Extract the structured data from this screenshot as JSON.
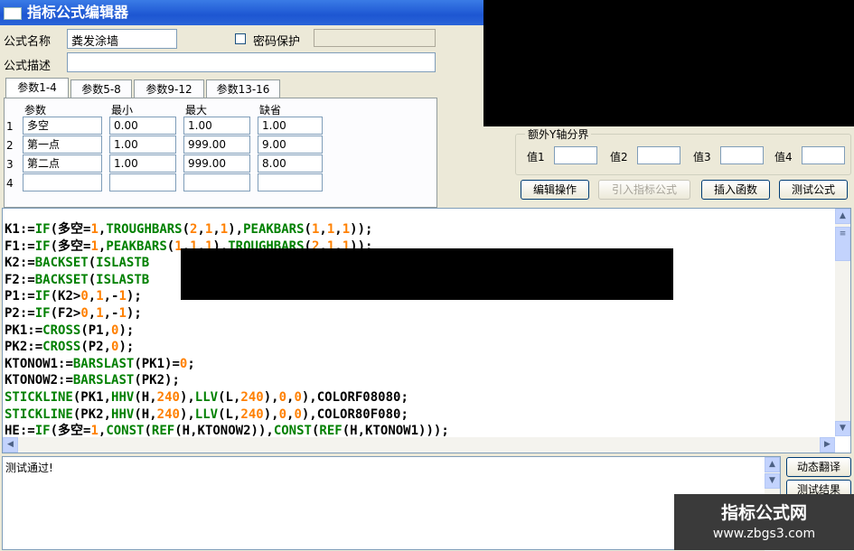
{
  "window": {
    "title": "指标公式编辑器"
  },
  "form": {
    "name_label": "公式名称",
    "name_value": "粪发涂墙",
    "password_label": "密码保护",
    "password_value": "",
    "password_checked": false,
    "desc_label": "公式描述",
    "desc_value": ""
  },
  "tabs": [
    {
      "label": "参数1-4",
      "active": true
    },
    {
      "label": "参数5-8",
      "active": false
    },
    {
      "label": "参数9-12",
      "active": false
    },
    {
      "label": "参数13-16",
      "active": false
    }
  ],
  "params": {
    "headers": [
      "参数",
      "最小",
      "最大",
      "缺省"
    ],
    "rows": [
      {
        "num": "1",
        "name": "多空",
        "min": "0.00",
        "max": "1.00",
        "def": "1.00"
      },
      {
        "num": "2",
        "name": "第一点",
        "min": "1.00",
        "max": "999.00",
        "def": "9.00"
      },
      {
        "num": "3",
        "name": "第二点",
        "min": "1.00",
        "max": "999.00",
        "def": "8.00"
      },
      {
        "num": "4",
        "name": "",
        "min": "",
        "max": "",
        "def": ""
      }
    ]
  },
  "y_axis": {
    "legend": "额外Y轴分界",
    "labels": [
      "值1",
      "值2",
      "值3",
      "值4"
    ],
    "values": [
      "",
      "",
      "",
      ""
    ]
  },
  "buttons": {
    "edit_ops": "编辑操作",
    "import_formula": "引入指标公式",
    "insert_function": "插入函数",
    "test_formula": "测试公式",
    "dynamic_translate": "动态翻译",
    "test_result": "测试结果"
  },
  "code_lines": [
    "K1:=IF(多空=1,TROUGHBARS(2,1,1),PEAKBARS(1,1,1));",
    "F1:=IF(多空=1,PEAKBARS(1,1,1),TROUGHBARS(2,1,1));",
    "K2:=BACKSET(ISLASTB",
    "F2:=BACKSET(ISLASTB",
    "P1:=IF(K2>0,1,-1);",
    "P2:=IF(F2>0,1,-1);",
    "PK1:=CROSS(P1,0);",
    "PK2:=CROSS(P2,0);",
    "KTONOW1:=BARSLAST(PK1)=0;",
    "KTONOW2:=BARSLAST(PK2);",
    "STICKLINE(PK1,HHV(H,240),LLV(L,240),0,0),COLORF08080;",
    "STICKLINE(PK2,HHV(H,240),LLV(L,240),0,0),COLOR80F080;",
    "HE:=IF(多空=1,CONST(REF(H,KTONOW2)),CONST(REF(H,KTONOW1)));"
  ],
  "output": {
    "text": "测试通过!"
  },
  "watermark": {
    "line1": "指标公式网",
    "line2": "www.zbgs3.com"
  }
}
